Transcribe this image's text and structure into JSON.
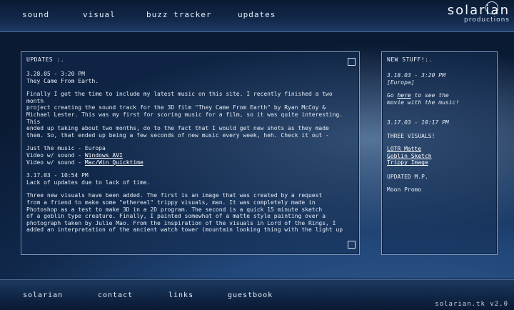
{
  "topnav": {
    "items": [
      "sound",
      "visual",
      "buzz tracker",
      "updates"
    ]
  },
  "logo": {
    "line1": "solarian",
    "line2": "productions"
  },
  "main": {
    "title": "UPDATES :.",
    "post1": {
      "date": "3.28.05 - 3:20 PM",
      "heading": "They Came From Earth.",
      "lines": [
        "Finally I got the time to include my latest music on this site. I recently finished a two month",
        "project creating the sound track for the 3D film \"They Came From Earth\" by Ryan McCoy &",
        "Michael Lester. This was my first for scoring music for a film, so it was quite interesting. This",
        "ended up taking about two months, do to the fact that I would get new shots as they made",
        "them. So, that ended up being a few seconds of new music every week, heh. Check it out -"
      ],
      "links": [
        {
          "prefix": "Just the music - ",
          "text": "Europa",
          "underline": false
        },
        {
          "prefix": "Video w/ sound - ",
          "text": "Windows AVI",
          "underline": true
        },
        {
          "prefix": "Video w/ sound - ",
          "text": "Mac/Win Quicktime",
          "underline": true
        }
      ]
    },
    "post2": {
      "date": "3.17.03 - 10:54 PM",
      "heading": "Lack of updates due to lack of time.",
      "lines": [
        "Three new visuals have been added. The first is an image that was created by a request",
        "from a friend to make some \"ethereal\" trippy visuals, man. It was completely made in",
        "Photoshop as a test to make 3D in a 2D program. The second is a quick 15 minute sketch",
        "of a goblin type creature. Finally, I painted somewhat of a matte style painting over a",
        "photograph taken by Julie Mao. From the inspiration of the visuals in Lord of the Rings, I",
        "added an interpretation of the ancient watch tower (mountain looking thing with the light up"
      ]
    }
  },
  "side": {
    "title": "NEW STUFF!:.",
    "block1": {
      "date": "3.18.03 - 3:20 PM",
      "tag": "[Europa]",
      "pre": "Go ",
      "link": "here",
      "post": " to see the",
      "line2": "movie with the music!"
    },
    "block2": {
      "date": "3.17.03 - 10:17 PM",
      "heading": "THREE VISUALS!",
      "links": [
        "LOTR Matte",
        "Goblin Sketch",
        "Trippy Image"
      ]
    },
    "block3": {
      "heading": "UPDATED M.P.",
      "text": "Moon Promo"
    }
  },
  "footer": {
    "items": [
      "solarian",
      "contact",
      "links",
      "guestbook"
    ],
    "version": "solarian.tk v2.0"
  }
}
